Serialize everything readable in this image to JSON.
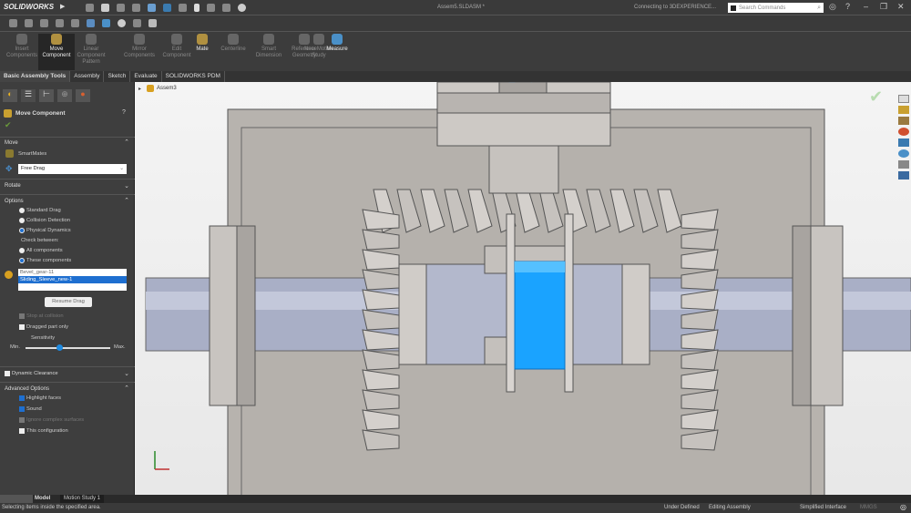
{
  "app": {
    "brand": "SOLIDWORKS",
    "doc_title": "Assem5.SLDASM *",
    "connecting": "Connecting to 3DEXPERIENCE...",
    "search_placeholder": "Search Commands"
  },
  "commands": [
    {
      "label": "Insert Components",
      "enabled": false
    },
    {
      "label": "Move Component",
      "enabled": true,
      "selected": true
    },
    {
      "label": "Linear Component Pattern",
      "enabled": false
    },
    {
      "label": "Mirror Components",
      "enabled": false
    },
    {
      "label": "Edit Component",
      "enabled": false
    },
    {
      "label": "Mate",
      "enabled": true
    },
    {
      "label": "Centerline",
      "enabled": false
    },
    {
      "label": "Smart Dimension",
      "enabled": false
    },
    {
      "label": "Reference Geometry",
      "enabled": false
    },
    {
      "label": "New Motion Study",
      "enabled": false
    },
    {
      "label": "Measure",
      "enabled": true
    }
  ],
  "tabs": [
    "Basic Assembly Tools",
    "Assembly",
    "Sketch",
    "Evaluate",
    "SOLIDWORKS PDM"
  ],
  "panel": {
    "title": "Move Component",
    "move": {
      "header": "Move",
      "smartmates": "SmartMates",
      "drag_mode": "Free Drag"
    },
    "rotate_header": "Rotate",
    "options": {
      "header": "Options",
      "standard_drag": "Standard Drag",
      "collision_detection": "Collision Detection",
      "physical_dynamics": "Physical Dynamics",
      "check_between": "Check between:",
      "all_components": "All components",
      "these_components": "These components",
      "components": [
        "Bevel_gear-11",
        "Sliding_Sleeve_new-1"
      ],
      "resume_drag": "Resume Drag",
      "stop_at_collision": "Stop at collision",
      "dragged_part_only": "Dragged part only",
      "sensitivity": "Sensitivity",
      "min": "Min.",
      "max": "Max.",
      "sensitivity_value": 0.4
    },
    "dynamic_clearance": "Dynamic Clearance",
    "advanced": {
      "header": "Advanced Options",
      "highlight_faces": "Highlight faces",
      "sound": "Sound",
      "ignore_complex": "Ignore complex surfaces",
      "this_configuration": "This configuration"
    }
  },
  "tree": {
    "root": "Assem3"
  },
  "bottom_tabs": [
    "Model",
    "Motion Study 1"
  ],
  "status": {
    "message": "Selecting items inside the specified area.",
    "state": "Under Defined",
    "mode": "Editing Assembly",
    "interface": "Simplified Interface",
    "units": "MMGS"
  },
  "colors": {
    "highlight": "#1aa3ff",
    "selection": "#1e6fd0"
  }
}
